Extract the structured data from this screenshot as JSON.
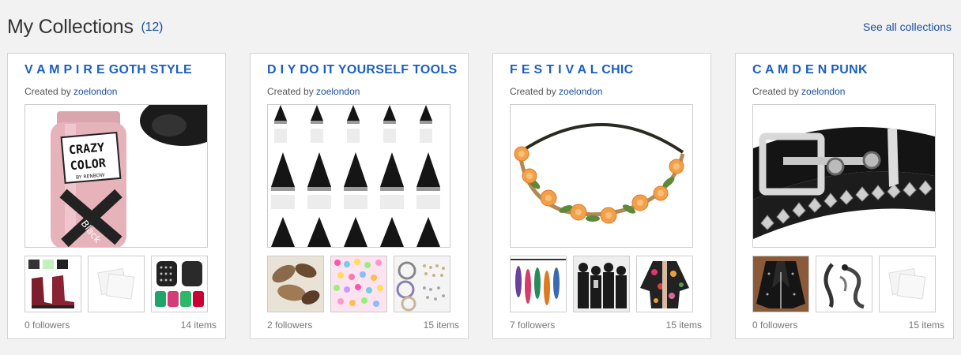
{
  "header": {
    "title": "My Collections",
    "count": "(12)",
    "see_all": "See all collections"
  },
  "collections": [
    {
      "title": "V A M P I R E GOTH STYLE",
      "created_by_label": "Created by",
      "user": "zoelondon",
      "followers": "0 followers",
      "items": "14 items",
      "main_image": "crazy-color-hair-dye-bottle",
      "main_image_text": {
        "line1": "CRAZY",
        "line2": "COLOR",
        "brand": "BY RENBOW",
        "shade": "Black"
      },
      "thumbs": [
        "burgundy-lace-up-boots",
        "placeholder-photo-icon",
        "studded-backpacks"
      ]
    },
    {
      "title": "D I Y DO IT YOURSELF TOOLS",
      "created_by_label": "Created by",
      "user": "zoelondon",
      "followers": "2 followers",
      "items": "15 items",
      "main_image": "black-spike-studs",
      "thumbs": [
        "feathers",
        "colorful-beads",
        "craft-supplies-tray"
      ]
    },
    {
      "title": "F E S T I V A L CHIC",
      "created_by_label": "Created by",
      "user": "zoelondon",
      "followers": "7 followers",
      "items": "15 items",
      "main_image": "orange-rose-flower-headband",
      "thumbs": [
        "feather-earrings",
        "band-photo",
        "floral-kimono"
      ]
    },
    {
      "title": "C A M D E N PUNK",
      "created_by_label": "Created by",
      "user": "zoelondon",
      "followers": "0 followers",
      "items": "15 items",
      "main_image": "studded-leather-belt",
      "thumbs": [
        "leather-biker-jacket",
        "dragon-ear-cuff",
        "placeholder-photo-icon"
      ]
    }
  ],
  "colors": {
    "page_bg": "#f2f2f2",
    "link": "#1a4fa0",
    "title_link": "#1a5fc0",
    "muted": "#777777"
  }
}
